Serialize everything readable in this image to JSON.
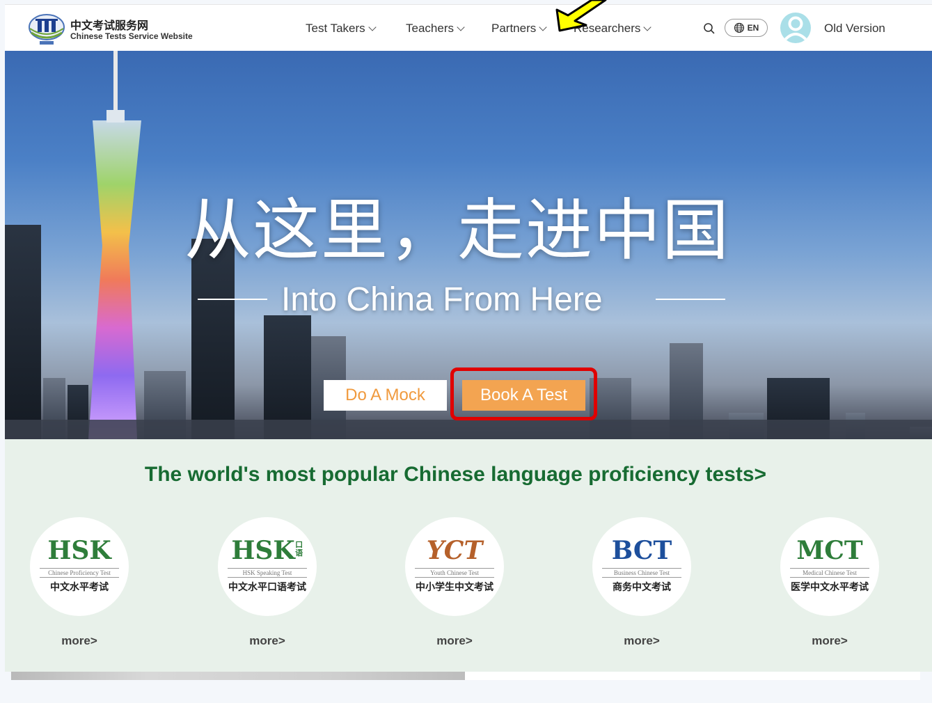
{
  "header": {
    "logo_cn": "中文考试服务网",
    "logo_en": "Chinese Tests Service Website",
    "nav": [
      {
        "label": "Test Takers"
      },
      {
        "label": "Teachers"
      },
      {
        "label": "Partners"
      },
      {
        "label": "Researchers"
      }
    ],
    "lang_label": "EN",
    "old_version_label": "Old Version"
  },
  "hero": {
    "headline_cn": "从这里，走进中国",
    "headline_en": "Into China From Here",
    "mock_button": "Do A Mock",
    "book_button": "Book A Test"
  },
  "tests": {
    "title": "The world's most popular Chinese language proficiency tests>",
    "items": [
      {
        "logo": "HSK",
        "logo_sup": "",
        "subtitle": "Chinese Proficiency Test",
        "cn": "中文水平考试",
        "more": "more>",
        "color": "#2e7d3a"
      },
      {
        "logo": "HSK",
        "logo_sup": "口语",
        "subtitle": "HSK Speaking Test",
        "cn": "中文水平口语考试",
        "more": "more>",
        "color": "#2e7d3a"
      },
      {
        "logo": "YCT",
        "logo_sup": "",
        "subtitle": "Youth Chinese Test",
        "cn": "中小学生中文考试",
        "more": "more>",
        "color": "#b5602a"
      },
      {
        "logo": "BCT",
        "logo_sup": "",
        "subtitle": "Business Chinese Test",
        "cn": "商务中文考试",
        "more": "more>",
        "color": "#1d4f9c"
      },
      {
        "logo": "MCT",
        "logo_sup": "",
        "subtitle": "Medical Chinese Test",
        "cn": "医学中文水平考试",
        "more": "more>",
        "color": "#2e7d3a"
      }
    ]
  },
  "colors": {
    "accent_orange": "#f3a451",
    "title_green": "#176b32",
    "highlight_red": "#e00000",
    "annotation_yellow": "#ffff00"
  }
}
